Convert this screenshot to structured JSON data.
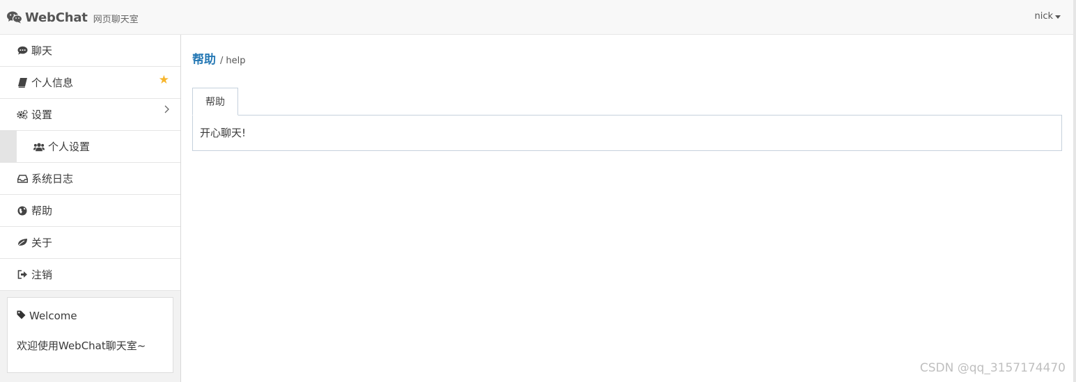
{
  "navbar": {
    "brand_name": "WebChat",
    "brand_sub": "网页聊天室",
    "user": "nick",
    "brand_icon": "wechat-icon"
  },
  "sidebar": {
    "items": [
      {
        "label": "聊天",
        "icon": "comment-icon"
      },
      {
        "label": "个人信息",
        "icon": "book-icon",
        "badge_icon": "star-icon"
      },
      {
        "label": "设置",
        "icon": "cogs-icon",
        "chevron": "chevron-right-icon"
      },
      {
        "label": "个人设置",
        "icon": "users-icon"
      },
      {
        "label": "系统日志",
        "icon": "inbox-icon"
      },
      {
        "label": "帮助",
        "icon": "globe-icon"
      },
      {
        "label": "关于",
        "icon": "leaf-icon"
      },
      {
        "label": "注销",
        "icon": "sign-out-icon"
      }
    ],
    "welcome": {
      "title": "Welcome",
      "text": "欢迎使用WebChat聊天室~",
      "icon": "tag-icon"
    }
  },
  "main": {
    "title": "帮助",
    "separator": "/",
    "subtitle": "help",
    "tabs": [
      {
        "label": "帮助"
      }
    ],
    "tab_content": "开心聊天!"
  },
  "watermark": "CSDN @qq_3157174470",
  "colors": {
    "accent": "#2679b5",
    "star": "#f7b52c",
    "navbar_bg": "#f8f8f8",
    "sidebar_bg": "#f2f2f2"
  }
}
